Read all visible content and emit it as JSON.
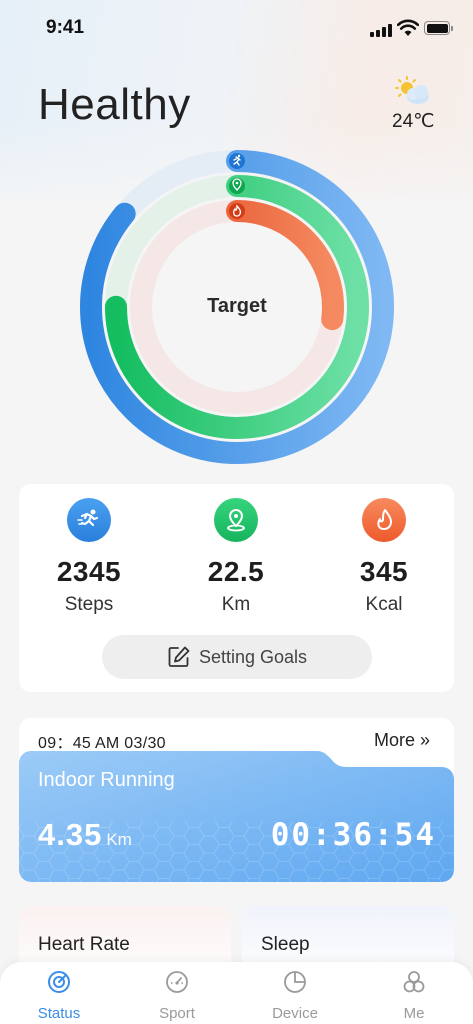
{
  "status_bar": {
    "time": "9:41"
  },
  "header": {
    "title": "Healthy",
    "temperature": "24℃",
    "weather_icon": "partly-sunny-icon"
  },
  "rings": {
    "center_label": "Target",
    "progress": {
      "steps": 0.86,
      "distance": 0.75,
      "calories": 0.27
    },
    "colors": {
      "steps": "#3a8ee6",
      "distance": "#1ec46a",
      "calories": "#e95a2a"
    }
  },
  "summary": {
    "metrics": [
      {
        "value": "2345",
        "unit": "Steps",
        "icon": "running-icon",
        "color": "#3a8ee6"
      },
      {
        "value": "22.5",
        "unit": "Km",
        "icon": "location-pin-icon",
        "color": "#1ec46a"
      },
      {
        "value": "345",
        "unit": "Kcal",
        "icon": "flame-icon",
        "color": "#f0643a"
      }
    ],
    "goals_button": "Setting Goals"
  },
  "activity": {
    "time": "09：45 AM 03/30",
    "more": "More »",
    "title": "Indoor Running",
    "distance": "4.35",
    "distance_unit": "Km",
    "duration": "00:36:54"
  },
  "cards": {
    "heart_rate": "Heart Rate",
    "sleep": "Sleep"
  },
  "tabbar": {
    "tabs": [
      {
        "label": "Status",
        "icon": "status-gauge-icon",
        "active": true
      },
      {
        "label": "Sport",
        "icon": "sport-speedometer-icon",
        "active": false
      },
      {
        "label": "Device",
        "icon": "device-pie-icon",
        "active": false
      },
      {
        "label": "Me",
        "icon": "me-profile-icon",
        "active": false
      }
    ]
  }
}
